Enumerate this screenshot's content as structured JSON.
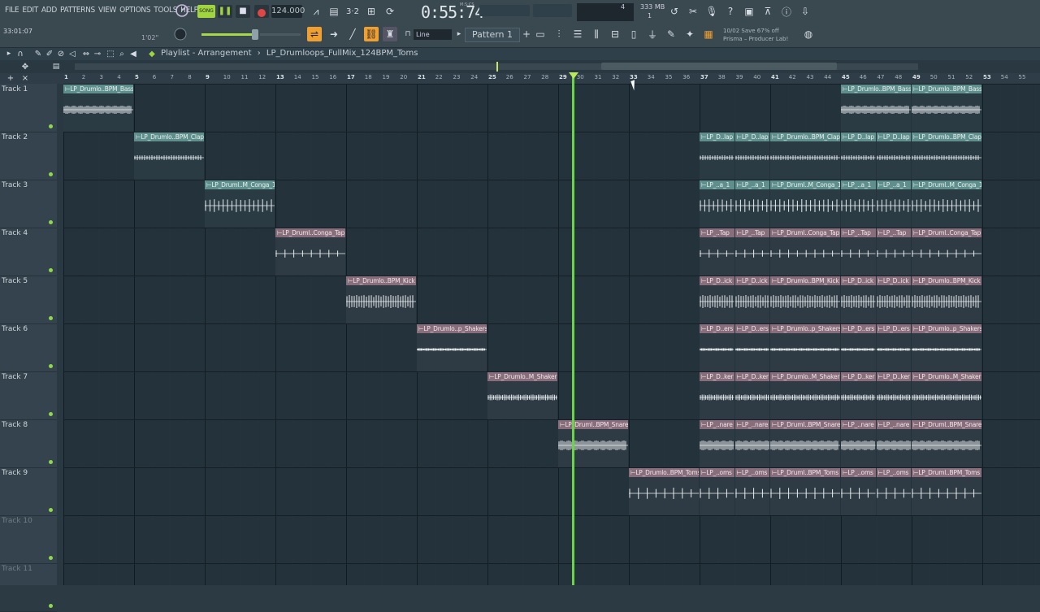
{
  "menu": [
    "FILE",
    "EDIT",
    "ADD",
    "PATTERNS",
    "VIEW",
    "OPTIONS",
    "TOOLS",
    "HELP"
  ],
  "hint": {
    "position": "33:01:07",
    "duration": "1'02\""
  },
  "transport": {
    "mode": "SONG",
    "tempo": "124.000",
    "time": "0:55:74",
    "time_unit": "M:S:CS"
  },
  "cpu": {
    "mem": "333 MB",
    "poly": "4",
    "voices": "1"
  },
  "snap": "Line",
  "pattern": "Pattern 1",
  "news": {
    "line1": "10/02  Save 67% off",
    "line2": "Prisma – Producer Lab!"
  },
  "playlist": {
    "title": "Playlist - Arrangement",
    "arrow": "›",
    "song": "LP_Drumloops_FullMix_124BPM_Toms"
  },
  "ruler": [
    1,
    2,
    3,
    4,
    5,
    6,
    7,
    8,
    9,
    10,
    11,
    12,
    13,
    14,
    15,
    16,
    17,
    18,
    19,
    20,
    21,
    22,
    23,
    24,
    25,
    26,
    27,
    28,
    29,
    30,
    31,
    32,
    33,
    34,
    35,
    36,
    37,
    38,
    39,
    40,
    41,
    42,
    43,
    44,
    45,
    46,
    47,
    48,
    49,
    50,
    51,
    52,
    53,
    54,
    55
  ],
  "tracks": [
    "Track 1",
    "Track 2",
    "Track 3",
    "Track 4",
    "Track 5",
    "Track 6",
    "Track 7",
    "Track 8",
    "Track 9",
    "Track 10",
    "Track 11"
  ],
  "clips": [
    {
      "track": 0,
      "bar": 1,
      "len": 4,
      "label": "⊢LP_Drumlo..BPM_Bass",
      "color": "teal",
      "wave": "bass"
    },
    {
      "track": 0,
      "bar": 45,
      "len": 4,
      "label": "⊢LP_Drumlo..BPM_Bass",
      "color": "teal",
      "wave": "bass"
    },
    {
      "track": 0,
      "bar": 49,
      "len": 4,
      "label": "⊢LP_Drumlo..BPM_Bass",
      "color": "teal",
      "wave": "bass"
    },
    {
      "track": 1,
      "bar": 5,
      "len": 4,
      "label": "⊢LP_Drumlo..BPM_Clap",
      "color": "teal",
      "wave": "clap"
    },
    {
      "track": 1,
      "bar": 37,
      "len": 2,
      "label": "⊢LP_D..lap",
      "color": "teal",
      "wave": "clap"
    },
    {
      "track": 1,
      "bar": 39,
      "len": 2,
      "label": "⊢LP_D..lap",
      "color": "teal",
      "wave": "clap"
    },
    {
      "track": 1,
      "bar": 41,
      "len": 4,
      "label": "⊢LP_Drumlo..BPM_Clap",
      "color": "teal",
      "wave": "clap"
    },
    {
      "track": 1,
      "bar": 45,
      "len": 2,
      "label": "⊢LP_D..lap",
      "color": "teal",
      "wave": "clap"
    },
    {
      "track": 1,
      "bar": 47,
      "len": 2,
      "label": "⊢LP_D..lap",
      "color": "teal",
      "wave": "clap"
    },
    {
      "track": 1,
      "bar": 49,
      "len": 4,
      "label": "⊢LP_Drumlo..BPM_Clap",
      "color": "teal",
      "wave": "clap"
    },
    {
      "track": 2,
      "bar": 9,
      "len": 4,
      "label": "⊢LP_Druml..M_Conga_1",
      "color": "teal",
      "wave": "conga"
    },
    {
      "track": 2,
      "bar": 37,
      "len": 2,
      "label": "⊢LP_..a_1",
      "color": "teal",
      "wave": "conga"
    },
    {
      "track": 2,
      "bar": 39,
      "len": 2,
      "label": "⊢LP_..a_1",
      "color": "teal",
      "wave": "conga"
    },
    {
      "track": 2,
      "bar": 41,
      "len": 4,
      "label": "⊢LP_Druml..M_Conga_1",
      "color": "teal",
      "wave": "conga"
    },
    {
      "track": 2,
      "bar": 45,
      "len": 2,
      "label": "⊢LP_..a_1",
      "color": "teal",
      "wave": "conga"
    },
    {
      "track": 2,
      "bar": 47,
      "len": 2,
      "label": "⊢LP_..a_1",
      "color": "teal",
      "wave": "conga"
    },
    {
      "track": 2,
      "bar": 49,
      "len": 4,
      "label": "⊢LP_Druml..M_Conga_1",
      "color": "teal",
      "wave": "conga"
    },
    {
      "track": 3,
      "bar": 13,
      "len": 4,
      "label": "⊢LP_Druml..Conga_Tap",
      "color": "pink",
      "wave": "tap"
    },
    {
      "track": 3,
      "bar": 37,
      "len": 2,
      "label": "⊢LP_..Tap",
      "color": "pink",
      "wave": "tap"
    },
    {
      "track": 3,
      "bar": 39,
      "len": 2,
      "label": "⊢LP_..Tap",
      "color": "pink",
      "wave": "tap"
    },
    {
      "track": 3,
      "bar": 41,
      "len": 4,
      "label": "⊢LP_Druml..Conga_Tap",
      "color": "pink",
      "wave": "tap"
    },
    {
      "track": 3,
      "bar": 45,
      "len": 2,
      "label": "⊢LP_..Tap",
      "color": "pink",
      "wave": "tap"
    },
    {
      "track": 3,
      "bar": 47,
      "len": 2,
      "label": "⊢LP_..Tap",
      "color": "pink",
      "wave": "tap"
    },
    {
      "track": 3,
      "bar": 49,
      "len": 4,
      "label": "⊢LP_Druml..Conga_Tap",
      "color": "pink",
      "wave": "tap"
    },
    {
      "track": 4,
      "bar": 17,
      "len": 4,
      "label": "⊢LP_Drumlo..BPM_Kick",
      "color": "pink",
      "wave": "kick"
    },
    {
      "track": 4,
      "bar": 37,
      "len": 2,
      "label": "⊢LP_D..ick",
      "color": "pink",
      "wave": "kick"
    },
    {
      "track": 4,
      "bar": 39,
      "len": 2,
      "label": "⊢LP_D..ick",
      "color": "pink",
      "wave": "kick"
    },
    {
      "track": 4,
      "bar": 41,
      "len": 4,
      "label": "⊢LP_Drumlo..BPM_Kick",
      "color": "pink",
      "wave": "kick"
    },
    {
      "track": 4,
      "bar": 45,
      "len": 2,
      "label": "⊢LP_D..ick",
      "color": "pink",
      "wave": "kick"
    },
    {
      "track": 4,
      "bar": 47,
      "len": 2,
      "label": "⊢LP_D..ick",
      "color": "pink",
      "wave": "kick"
    },
    {
      "track": 4,
      "bar": 49,
      "len": 4,
      "label": "⊢LP_Drumlo..BPM_Kick",
      "color": "pink",
      "wave": "kick"
    },
    {
      "track": 5,
      "bar": 21,
      "len": 4,
      "label": "⊢LP_Drumlo..p_Shakers",
      "color": "pink",
      "wave": "shaker"
    },
    {
      "track": 5,
      "bar": 37,
      "len": 2,
      "label": "⊢LP_D..ers",
      "color": "pink",
      "wave": "shaker"
    },
    {
      "track": 5,
      "bar": 39,
      "len": 2,
      "label": "⊢LP_D..ers",
      "color": "pink",
      "wave": "shaker"
    },
    {
      "track": 5,
      "bar": 41,
      "len": 4,
      "label": "⊢LP_Drumlo..p_Shakers",
      "color": "pink",
      "wave": "shaker"
    },
    {
      "track": 5,
      "bar": 45,
      "len": 2,
      "label": "⊢LP_D..ers",
      "color": "pink",
      "wave": "shaker"
    },
    {
      "track": 5,
      "bar": 47,
      "len": 2,
      "label": "⊢LP_D..ers",
      "color": "pink",
      "wave": "shaker"
    },
    {
      "track": 5,
      "bar": 49,
      "len": 4,
      "label": "⊢LP_Drumlo..p_Shakers",
      "color": "pink",
      "wave": "shaker"
    },
    {
      "track": 6,
      "bar": 25,
      "len": 4,
      "label": "⊢LP_Drumlo..M_Shaker",
      "color": "pink",
      "wave": "shaker2"
    },
    {
      "track": 6,
      "bar": 37,
      "len": 2,
      "label": "⊢LP_D..ker",
      "color": "pink",
      "wave": "shaker2"
    },
    {
      "track": 6,
      "bar": 39,
      "len": 2,
      "label": "⊢LP_D..ker",
      "color": "pink",
      "wave": "shaker2"
    },
    {
      "track": 6,
      "bar": 41,
      "len": 4,
      "label": "⊢LP_Drumlo..M_Shaker",
      "color": "pink",
      "wave": "shaker2"
    },
    {
      "track": 6,
      "bar": 45,
      "len": 2,
      "label": "⊢LP_D..ker",
      "color": "pink",
      "wave": "shaker2"
    },
    {
      "track": 6,
      "bar": 47,
      "len": 2,
      "label": "⊢LP_D..ker",
      "color": "pink",
      "wave": "shaker2"
    },
    {
      "track": 6,
      "bar": 49,
      "len": 4,
      "label": "⊢LP_Drumlo..M_Shaker",
      "color": "pink",
      "wave": "shaker2"
    },
    {
      "track": 7,
      "bar": 29,
      "len": 4,
      "label": "⊢LP_Druml..BPM_Snare",
      "color": "pink",
      "wave": "snare"
    },
    {
      "track": 7,
      "bar": 37,
      "len": 2,
      "label": "⊢LP_..nare",
      "color": "pink",
      "wave": "snare"
    },
    {
      "track": 7,
      "bar": 39,
      "len": 2,
      "label": "⊢LP_..nare",
      "color": "pink",
      "wave": "snare"
    },
    {
      "track": 7,
      "bar": 41,
      "len": 4,
      "label": "⊢LP_Druml..BPM_Snare",
      "color": "pink",
      "wave": "snare"
    },
    {
      "track": 7,
      "bar": 45,
      "len": 2,
      "label": "⊢LP_..nare",
      "color": "pink",
      "wave": "snare"
    },
    {
      "track": 7,
      "bar": 47,
      "len": 2,
      "label": "⊢LP_..nare",
      "color": "pink",
      "wave": "snare"
    },
    {
      "track": 7,
      "bar": 49,
      "len": 4,
      "label": "⊢LP_Druml..BPM_Snare",
      "color": "pink",
      "wave": "snare"
    },
    {
      "track": 8,
      "bar": 33,
      "len": 4,
      "label": "⊢LP_Drumlo..BPM_Toms",
      "color": "pink",
      "wave": "toms"
    },
    {
      "track": 8,
      "bar": 37,
      "len": 2,
      "label": "⊢LP_..oms",
      "color": "pink",
      "wave": "toms"
    },
    {
      "track": 8,
      "bar": 39,
      "len": 2,
      "label": "⊢LP_..oms",
      "color": "pink",
      "wave": "toms"
    },
    {
      "track": 8,
      "bar": 41,
      "len": 4,
      "label": "⊢LP_Druml..BPM_Toms",
      "color": "pink",
      "wave": "toms"
    },
    {
      "track": 8,
      "bar": 45,
      "len": 2,
      "label": "⊢LP_..oms",
      "color": "pink",
      "wave": "toms"
    },
    {
      "track": 8,
      "bar": 47,
      "len": 2,
      "label": "⊢LP_..oms",
      "color": "pink",
      "wave": "toms"
    },
    {
      "track": 8,
      "bar": 49,
      "len": 4,
      "label": "⊢LP_Druml..BPM_Toms",
      "color": "pink",
      "wave": "toms"
    }
  ],
  "playhead_bar": 30.2,
  "colors": {
    "playhead": "#6cd448",
    "clip_teal": "#5f8f8c",
    "clip_pink": "#876e7a",
    "record": "#e04646",
    "accent": "#f0a030"
  }
}
